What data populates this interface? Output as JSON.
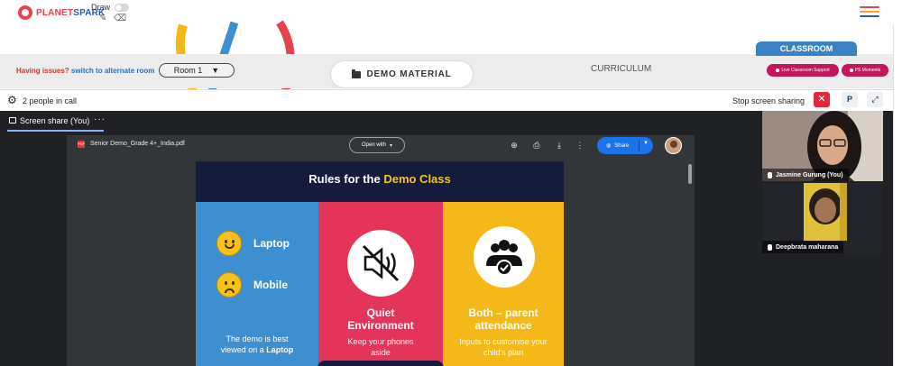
{
  "header": {
    "logo_planet": "PLANET",
    "logo_spark": "SPARK",
    "draw_label": "Draw"
  },
  "roomstrip": {
    "issues_text": "Having issues?",
    "alternate_link": "switch to alternate room",
    "room_selected": "Room 1",
    "demo_material": "DEMO MATERIAL",
    "curriculum": "CURRICULUM",
    "classroom_tab": "CLASSROOM",
    "live_support": "Live Classroom Support",
    "ps_moments": "PS Moments"
  },
  "call": {
    "people_count": "2 people in call",
    "stop_sharing": "Stop screen sharing",
    "close_glyph": "✕",
    "p_label": "P",
    "expand_glyph": "⤢",
    "screen_share_tab": "Screen share (You)",
    "more_glyph": "···"
  },
  "pdf": {
    "filename": "Senior Demo_Grade 4+_India.pdf",
    "open_with": "Open with",
    "share": "Share"
  },
  "slide": {
    "title_part1": "Rules for the",
    "title_part2": "Demo Class",
    "laptop": "Laptop",
    "mobile": "Mobile",
    "blue_note_line1": "The demo is best",
    "blue_note_line2_a": "viewed on a",
    "blue_note_line2_b": "Laptop",
    "quiet_line1": "Quiet",
    "quiet_line2": "Environment",
    "quiet_sub_line1": "Keep your phones",
    "quiet_sub_line2": "aside",
    "both_line1": "Both – parent",
    "both_line2": "attendance",
    "both_sub_line1": "Inputs to customise your",
    "both_sub_line2": "child's plan"
  },
  "participants": [
    {
      "name": "Jasmine Gurung (You)"
    },
    {
      "name": "Deepbrata maharana"
    }
  ],
  "colors": {
    "brand_red": "#e8424f",
    "brand_blue": "#2e5aa8",
    "classroom_blue": "#3b82c4",
    "support_pink": "#c2185b",
    "stop_red": "#e0293b",
    "slide_navy": "#151b3d",
    "slide_blue": "#3e8fcf",
    "slide_red": "#e5345a",
    "slide_yellow": "#f5b819"
  },
  "icons": [
    "planetspark-logo-icon",
    "pencil-icon",
    "eraser-icon",
    "hamburger-menu-icon",
    "folder-icon",
    "gear-icon",
    "close-icon",
    "expand-icon",
    "screen-share-icon",
    "pdf-file-icon",
    "add-drive-icon",
    "print-icon",
    "download-icon",
    "more-vert-icon",
    "globe-icon",
    "mute-speaker-icon",
    "people-check-icon",
    "mic-icon"
  ]
}
